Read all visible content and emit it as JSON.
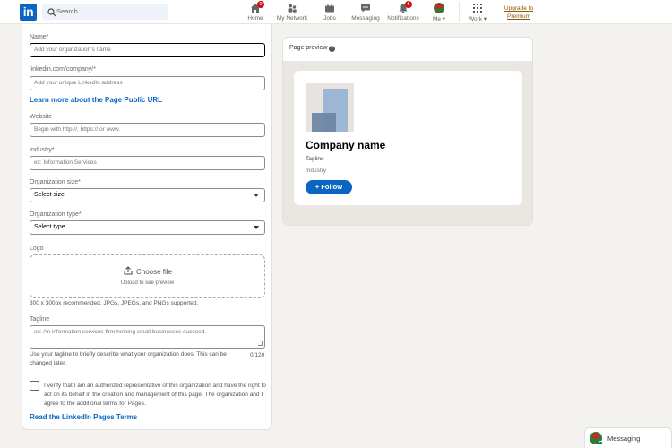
{
  "nav": {
    "logo": "in",
    "search_placeholder": "Search",
    "items": [
      {
        "label": "Home",
        "badge": "9"
      },
      {
        "label": "My Network",
        "badge": ""
      },
      {
        "label": "Jobs",
        "badge": ""
      },
      {
        "label": "Messaging",
        "badge": ""
      },
      {
        "label": "Notifications",
        "badge": "5"
      },
      {
        "label": "Me ▾",
        "badge": ""
      },
      {
        "label": "Work ▾",
        "badge": ""
      }
    ],
    "premium": "Upgrade to Premium"
  },
  "form": {
    "name_label": "Name*",
    "name_placeholder": "Add your organization's name",
    "url_label": "linkedin.com/company/*",
    "url_placeholder": "Add your unique LinkedIn address",
    "url_link": "Learn more about the Page Public URL",
    "website_label": "Website",
    "website_placeholder": "Begin with http://, https:// or www.",
    "industry_label": "Industry*",
    "industry_placeholder": "ex: Information Services",
    "size_label": "Organization size*",
    "size_value": "Select size",
    "type_label": "Organization type*",
    "type_value": "Select type",
    "logo_label": "Logo",
    "logo_button": "Choose file",
    "logo_sub": "Upload to see preview",
    "logo_help": "300 x 300px recommended. JPGs, JPEGs, and PNGs supported.",
    "tagline_label": "Tagline",
    "tagline_placeholder": "ex: An information services firm helping small businesses succeed.",
    "tagline_help": "Use your tagline to briefly describe what your organization does. This can be changed later.",
    "tagline_counter": "0/120",
    "verify_text": "I verify that I am an authorized representative of this organization and have the right to act on its behalf in the creation and management of this page. The organization and I agree to the additional terms for Pages.",
    "terms_link": "Read the LinkedIn Pages Terms"
  },
  "preview": {
    "heading": "Page preview",
    "company_name": "Company name",
    "tagline": "Tagline",
    "industry": "Industry",
    "follow": "+ Follow"
  },
  "messaging": {
    "label": "Messaging"
  },
  "colors": {
    "accent": "#0a66c2",
    "badge": "#cc1016",
    "premium": "#915907",
    "online": "#057642"
  }
}
